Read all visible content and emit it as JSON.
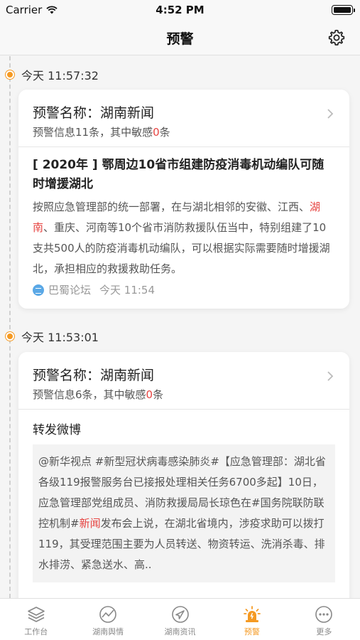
{
  "status_bar": {
    "carrier": "Carrier",
    "time": "4:52 PM"
  },
  "nav": {
    "title": "预警"
  },
  "feed": [
    {
      "time": "今天 11:57:32",
      "alert_name": "预警名称：湖南新闻",
      "info_prefix": "预警信息11条，其中敏感",
      "sensitive_count": "0",
      "info_suffix": "条",
      "article_title": "[ 2020年 ] 鄂周边10省市组建防疫消毒机动编队可随时增援湖北",
      "text_1": "按照应急管理部的统一部署，在与湖北相邻的安徽、江西、",
      "text_hl": "湖南",
      "text_2": "、重庆、河南等10个省市消防救援队伍当中，特别组建了10支共500人的防疫消毒机动编队，可以根据实际需要随时增援湖北，承担相应的救援救助任务。",
      "source": "巴蜀论坛",
      "source_time": "今天 11:54"
    },
    {
      "time": "今天 11:53:01",
      "alert_name": "预警名称：湖南新闻",
      "info_prefix": "预警信息6条，其中敏感",
      "sensitive_count": "0",
      "info_suffix": "条",
      "repost_label": "转发微博",
      "text_1": "@新华视点 #新型冠状病毒感染肺炎#【应急管理部：湖北省各级119报警服务台已接报处理相关任务6700多起】10日，应急管理部党组成员、消防救援局局长琼色在#国务院联防联控机制#",
      "text_hl": "新闻",
      "text_2": "发布会上说，在湖北省境内，涉疫求助可以拨打119，其受理范围主要为人员转送、物资转运、洗消杀毒、排水排涝、紧急送水、高.."
    }
  ],
  "tabs": [
    {
      "label": "工作台",
      "icon": "layers-icon"
    },
    {
      "label": "湖南舆情",
      "icon": "chart-icon"
    },
    {
      "label": "湖南资讯",
      "icon": "navigation-icon"
    },
    {
      "label": "预警",
      "icon": "alarm-icon",
      "active": true
    },
    {
      "label": "更多",
      "icon": "more-icon"
    }
  ],
  "colors": {
    "accent": "#f59a23",
    "highlight": "#e64340"
  }
}
